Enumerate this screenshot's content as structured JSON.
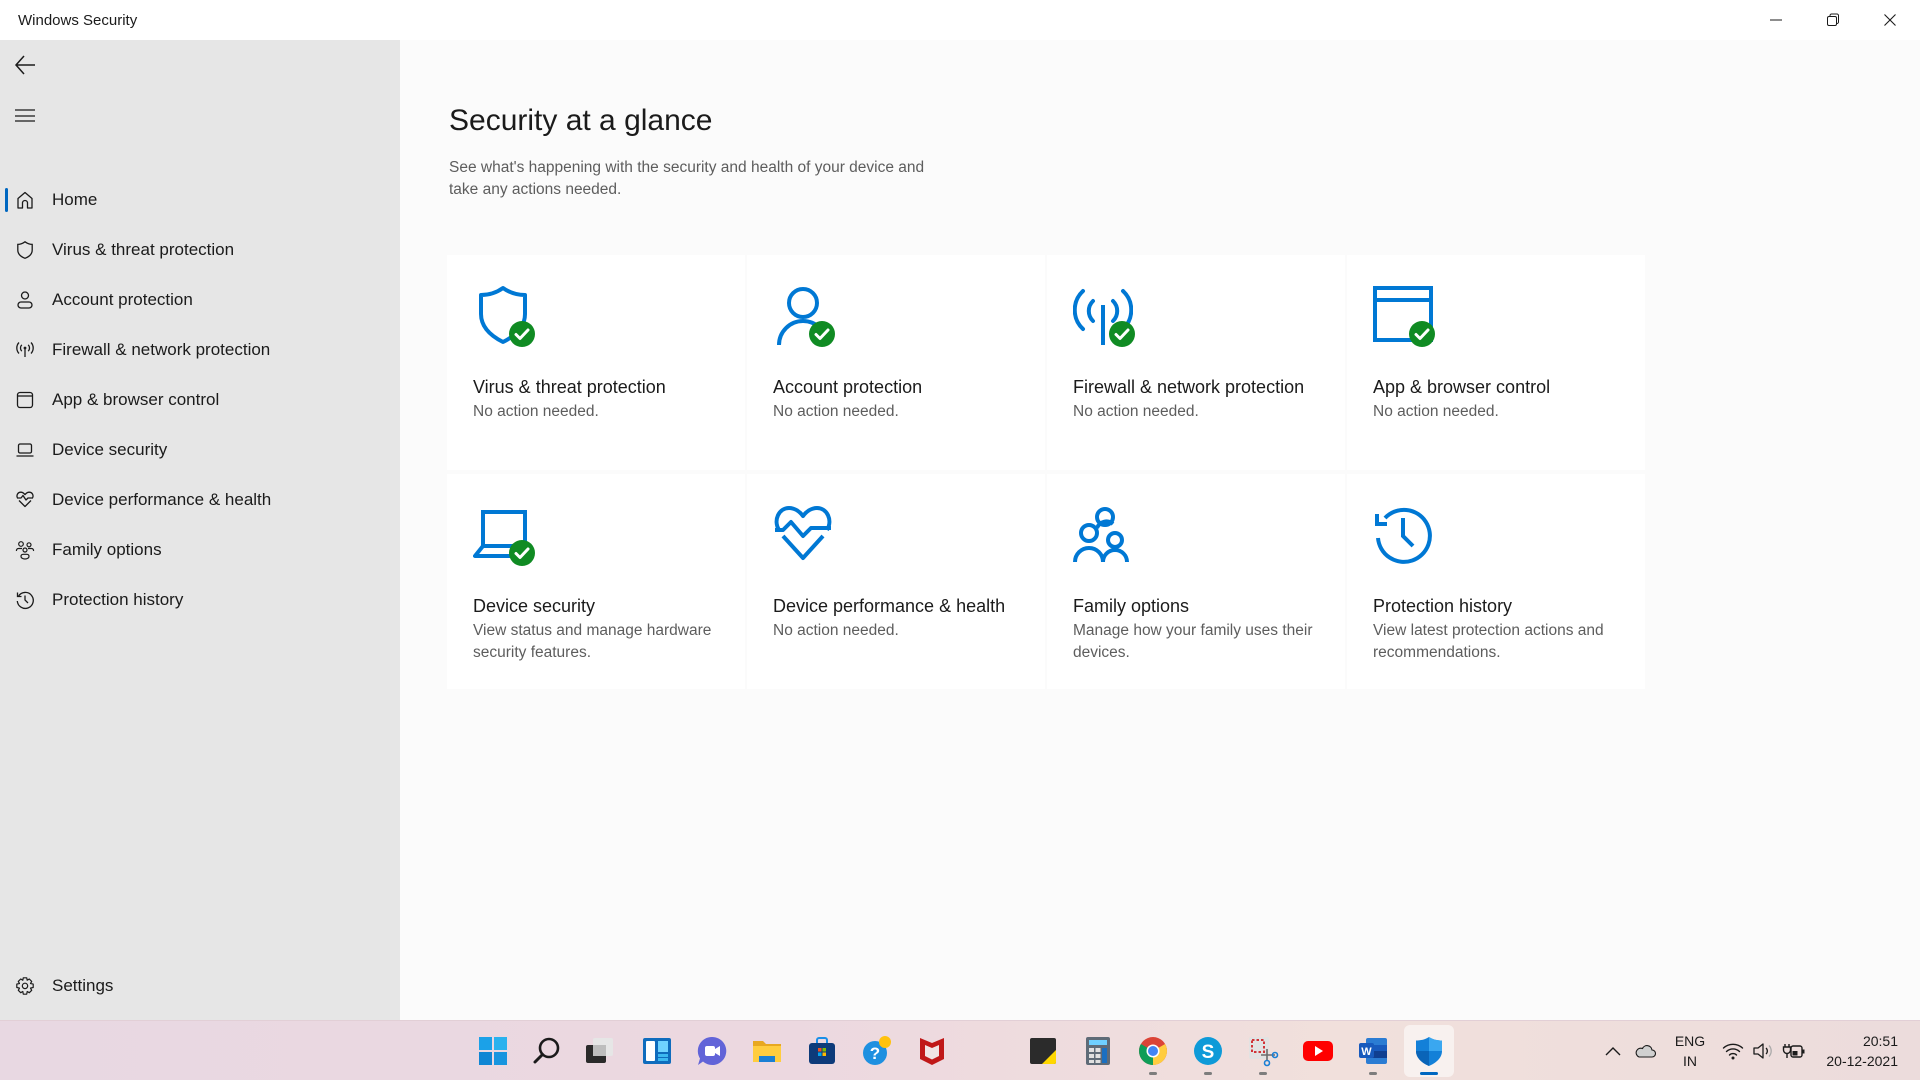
{
  "window": {
    "title": "Windows Security",
    "controls": {
      "minimize": "minimize",
      "maximize": "restore",
      "close": "close"
    }
  },
  "sidebar": {
    "back_icon": "back-arrow-icon",
    "menu_icon": "hamburger-icon",
    "items": [
      {
        "label": "Home",
        "icon": "home-icon",
        "active": true
      },
      {
        "label": "Virus & threat protection",
        "icon": "shield-icon",
        "active": false
      },
      {
        "label": "Account protection",
        "icon": "person-icon",
        "active": false
      },
      {
        "label": "Firewall & network protection",
        "icon": "antenna-icon",
        "active": false
      },
      {
        "label": "App & browser control",
        "icon": "browser-window-icon",
        "active": false
      },
      {
        "label": "Device security",
        "icon": "laptop-icon",
        "active": false
      },
      {
        "label": "Device performance & health",
        "icon": "heart-pulse-icon",
        "active": false
      },
      {
        "label": "Family options",
        "icon": "family-icon",
        "active": false
      },
      {
        "label": "Protection history",
        "icon": "history-icon",
        "active": false
      }
    ],
    "settings": {
      "label": "Settings",
      "icon": "gear-icon"
    }
  },
  "main": {
    "title": "Security at a glance",
    "description": "See what's happening with the security and health of your device and take any actions needed.",
    "cards": [
      {
        "title": "Virus & threat protection",
        "status": "No action needed.",
        "icon": "shield-icon",
        "ok": true
      },
      {
        "title": "Account protection",
        "status": "No action needed.",
        "icon": "person-icon",
        "ok": true
      },
      {
        "title": "Firewall & network protection",
        "status": "No action needed.",
        "icon": "antenna-icon",
        "ok": true
      },
      {
        "title": "App & browser control",
        "status": "No action needed.",
        "icon": "browser-window-icon",
        "ok": true
      },
      {
        "title": "Device security",
        "status": "View status and manage hardware security features.",
        "icon": "laptop-icon",
        "ok": true
      },
      {
        "title": "Device performance & health",
        "status": "No action needed.",
        "icon": "heart-pulse-icon",
        "ok": false
      },
      {
        "title": "Family options",
        "status": "Manage how your family uses their devices.",
        "icon": "family-icon",
        "ok": false
      },
      {
        "title": "Protection history",
        "status": "View latest protection actions and recommendations.",
        "icon": "history-icon",
        "ok": false
      }
    ],
    "colors": {
      "accent": "#0078d4",
      "ok_badge": "#108b23"
    }
  },
  "taskbar": {
    "apps": [
      {
        "name": "Start",
        "icon": "windows-start-icon",
        "running": false
      },
      {
        "name": "Search",
        "icon": "search-icon",
        "running": false
      },
      {
        "name": "Task View",
        "icon": "task-view-icon",
        "running": false
      },
      {
        "name": "Widgets",
        "icon": "widgets-icon",
        "running": false
      },
      {
        "name": "Chat",
        "icon": "teams-chat-icon",
        "running": false
      },
      {
        "name": "File Explorer",
        "icon": "folder-icon",
        "running": false
      },
      {
        "name": "Microsoft Store",
        "icon": "store-icon",
        "running": false
      },
      {
        "name": "Get Help",
        "icon": "help-icon",
        "running": false
      },
      {
        "name": "McAfee",
        "icon": "mcafee-icon",
        "running": false
      },
      {
        "name": "Sticky Notes",
        "icon": "sticky-notes-icon",
        "running": false
      },
      {
        "name": "Calculator",
        "icon": "calculator-icon",
        "running": false
      },
      {
        "name": "Google Chrome",
        "icon": "chrome-icon",
        "running": true
      },
      {
        "name": "Skype",
        "icon": "skype-icon",
        "running": true
      },
      {
        "name": "Snipping Tool",
        "icon": "snipping-tool-icon",
        "running": true
      },
      {
        "name": "YouTube",
        "icon": "youtube-icon",
        "running": false
      },
      {
        "name": "Word",
        "icon": "word-icon",
        "running": true
      },
      {
        "name": "Windows Security",
        "icon": "windows-security-icon",
        "running": true,
        "active": true
      }
    ],
    "tray": {
      "language_line1": "ENG",
      "language_line2": "IN",
      "time": "20:51",
      "date": "20-12-2021"
    }
  }
}
